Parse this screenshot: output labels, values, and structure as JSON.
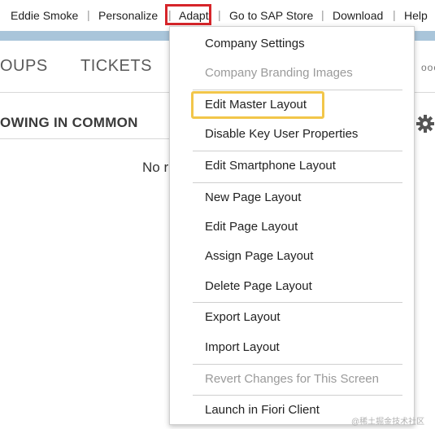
{
  "topbar": {
    "user": "Eddie Smoke",
    "personalize": "Personalize",
    "adapt": "Adapt",
    "sap_store": "Go to SAP Store",
    "download": "Download",
    "help": "Help",
    "separator": "|"
  },
  "tabs": {
    "groups": "OUPS",
    "tickets": "TICKETS",
    "overflow": "ooo"
  },
  "section": {
    "title": "OWING IN COMMON",
    "empty_text": "No r"
  },
  "menu": {
    "items": [
      {
        "label": "Company Settings",
        "enabled": true
      },
      {
        "label": "Company Branding Images",
        "enabled": false
      },
      {
        "label": "Edit Master Layout",
        "enabled": true,
        "highlighted": true
      },
      {
        "label": "Disable Key User Properties",
        "enabled": true
      },
      {
        "label": "Edit Smartphone Layout",
        "enabled": true
      },
      {
        "label": "New Page Layout",
        "enabled": true
      },
      {
        "label": "Edit Page Layout",
        "enabled": true
      },
      {
        "label": "Assign Page Layout",
        "enabled": true
      },
      {
        "label": "Delete Page Layout",
        "enabled": true
      },
      {
        "label": "Export Layout",
        "enabled": true
      },
      {
        "label": "Import Layout",
        "enabled": true
      },
      {
        "label": "Revert Changes for This Screen",
        "enabled": false
      },
      {
        "label": "Launch in Fiori Client",
        "enabled": true
      }
    ]
  },
  "colors": {
    "adapt_outline": "#d6252a",
    "highlight_outline": "#f2c64a",
    "header_strip": "#a9c5da",
    "disabled_text": "#9a9a9a"
  },
  "icons": {
    "settings": "gear-icon"
  },
  "watermark": "@稀土掘金技术社区"
}
